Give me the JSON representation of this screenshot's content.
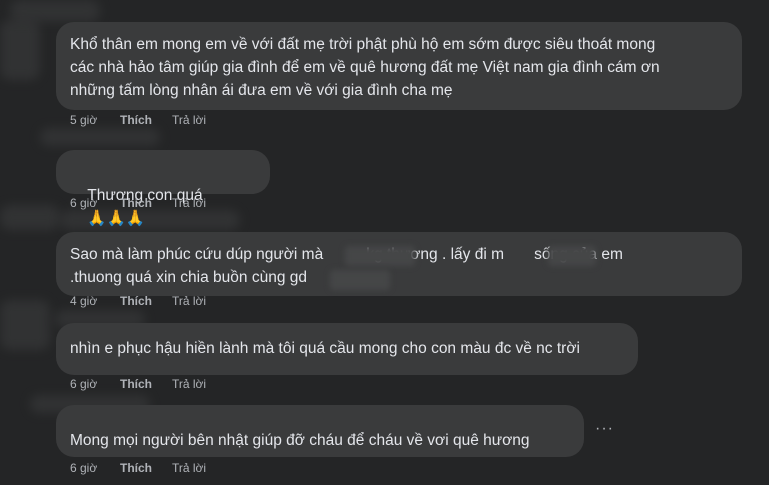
{
  "comments": [
    {
      "text_lines": [
        "Khổ thân em mong em về với đất mẹ trời phật phù hộ em sớm được siêu thoát mong",
        "các nhà hảo tâm giúp gia đình để em về quê hương đất mẹ Việt nam gia đình cám ơn",
        "những tấm lòng nhân ái đưa em về với gia đình cha mẹ"
      ],
      "time": "5 giờ",
      "like": "Thích",
      "reply": "Trả lời"
    },
    {
      "text": "Thương con quá",
      "emoji": "🙏🙏🙏",
      "time": "6 giờ",
      "like": "Thích",
      "reply": "Trả lời"
    },
    {
      "text_lines": [
        "Sao mà làm phúc cứu dúp người mà          kg thương . lấy đi m       sống của em",
        ".thuong quá xin chia buồn cùng gd"
      ],
      "time": "4 giờ",
      "like": "Thích",
      "reply": "Trả lời"
    },
    {
      "text": "nhìn e phục hậu hiền lành mà tôi quá cầu mong cho con màu đc về nc trời",
      "time": "6 giờ",
      "like": "Thích",
      "reply": "Trả lời"
    },
    {
      "text": "Mong mọi người bên nhật giúp đỡ cháu để cháu về vơi quê hương",
      "time": "6 giờ",
      "like": "Thích",
      "reply": "Trả lời",
      "more": "···"
    }
  ]
}
